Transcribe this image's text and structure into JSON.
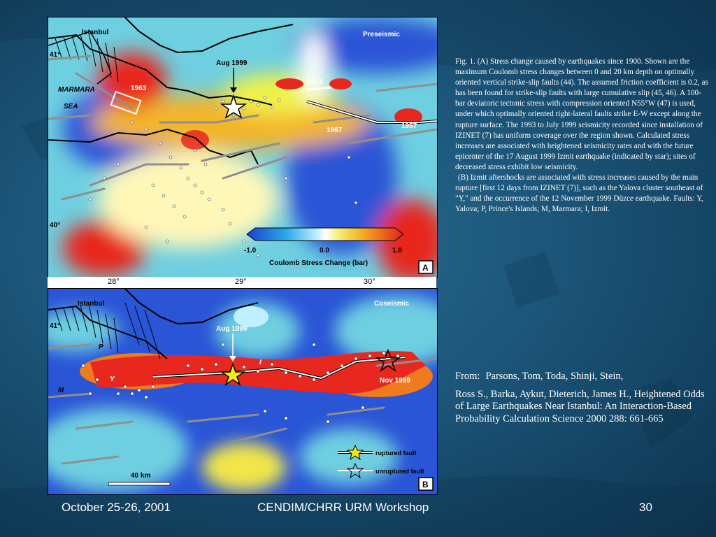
{
  "panel_a": {
    "label": "A",
    "state_label": "Preseismic",
    "event_label": "Aug 1999",
    "place_labels": [
      "Istanbul",
      "MARMARA",
      "SEA"
    ],
    "years": [
      "1963",
      "1943",
      "1967",
      "1957"
    ],
    "lat_labels": [
      "41°",
      "40°"
    ],
    "colorbar": {
      "min_label": "-1.0",
      "mid_label": "0.0",
      "max_label": "1.0",
      "title": "Coulomb Stress Change (bar)"
    }
  },
  "panel_b": {
    "label": "B",
    "state_label": "Coseismic",
    "event_label": "Aug 1999",
    "nov_label": "Nov 1999",
    "place_labels": [
      "Istanbul"
    ],
    "lat_label": "41°",
    "fault_letters": [
      "P",
      "M",
      "Y",
      "I"
    ],
    "legend": {
      "ruptured": "ruptured fault",
      "unruptured": "unruptured fault"
    },
    "scale_label": "40 km"
  },
  "lon_ticks": [
    "28°",
    "29°",
    "30°"
  ],
  "colors": {
    "background": "#1d587c",
    "stress_high": "#e8281e",
    "stress_low": "#2a55d6",
    "star_fill": "#f2e81a"
  },
  "caption": {
    "paragraph_a": "Fig. 1. (A) Stress change caused by earthquakes since 1900. Shown are the maximum Coulomb stress changes between 0 and 20 km depth on optimally oriented vertical strike-slip faults (44). The assumed friction coefficient is 0.2, as has been found for strike-slip faults with large cumulative slip (45, 46). A 100-bar deviatoric tectonic stress with compression oriented N55°W (47) is used, under which optimally oriented right-lateral faults strike E-W except along the rupture surface. The 1993 to July 1999 seismicity recorded since installation of IZINET (7) has uniform coverage over the region shown. Calculated stress increases are associated with heightened seismicity rates and with the future epicenter of the 17 August 1999 Izmit earthquake (indicated by star); sites of decreased stress exhibit low seismicity.",
    "paragraph_b": "(B) Izmit aftershocks are associated with stress increases caused by the main rupture [first 12 days from IZINET (7)], such as the Yalova cluster southeast of \"Y,\" and the occurrence of the 12 November 1999 Düzce earthquake. Faults: Y, Yalova; P, Prince's Islands; M, Marmara; I, Izmit."
  },
  "source": {
    "from_label": "From:",
    "authors_line1": "Parsons, Tom, Toda, Shinji, Stein,",
    "rest": "Ross S., Barka, Aykut, Dieterich, James H., Heightened Odds of Large Earthquakes Near Istanbul: An Interaction-Based Probability Calculation Science 2000 288: 661-665"
  },
  "footer": {
    "date": "October 25-26, 2001",
    "event": "CENDIM/CHRR URM Workshop",
    "page": "30"
  }
}
